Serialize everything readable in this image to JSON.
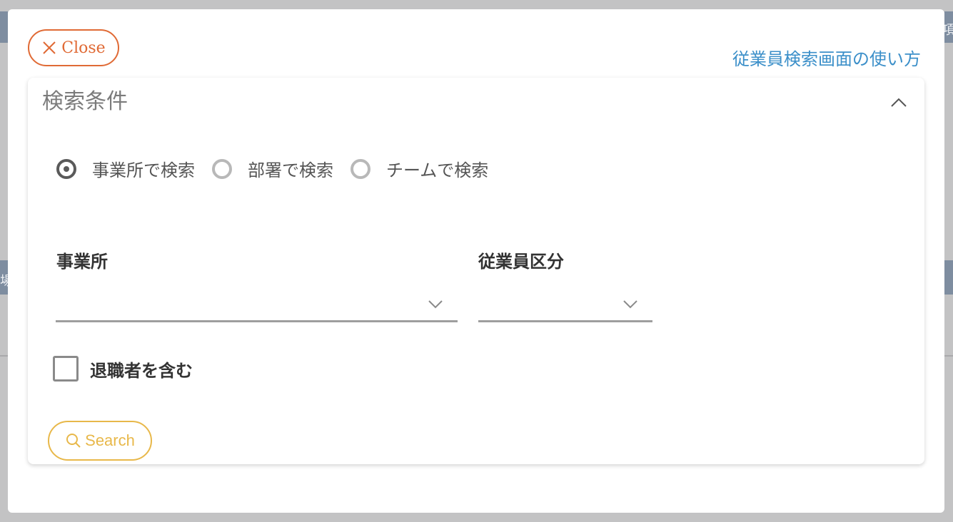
{
  "modal": {
    "close_label": "Close",
    "help_link": "従業員検索画面の使い方"
  },
  "search_panel": {
    "title": "検索条件",
    "search_modes": [
      {
        "label": "事業所で検索",
        "checked": true
      },
      {
        "label": "部署で検索",
        "checked": false
      },
      {
        "label": "チームで検索",
        "checked": false
      }
    ],
    "office_field": {
      "label": "事業所",
      "value": ""
    },
    "employee_type_field": {
      "label": "従業員区分",
      "value": ""
    },
    "include_retired": {
      "label": "退職者を含む",
      "checked": false
    },
    "search_label": "Search"
  },
  "colors": {
    "close_accent": "#e06a35",
    "link": "#3b8fc9",
    "search_accent": "#e8b84a"
  },
  "background": {
    "peek_texts": [
      "項",
      "場"
    ]
  }
}
